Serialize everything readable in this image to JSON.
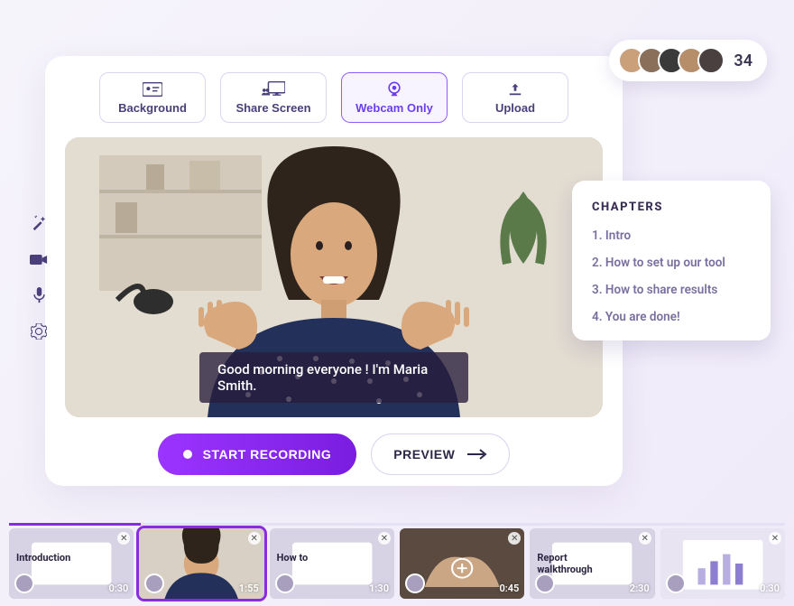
{
  "participants": {
    "count": "34"
  },
  "toolbar": {
    "background_label": "Background",
    "share_label": "Share Screen",
    "webcam_label": "Webcam Only",
    "upload_label": "Upload"
  },
  "caption": "Good morning everyone ! I'm Maria Smith.",
  "actions": {
    "record_label": "START RECORDING",
    "preview_label": "PREVIEW"
  },
  "chapters": {
    "heading": "CHAPTERS",
    "items": [
      "1. Intro",
      "2. How to set up our tool",
      "3. How to share results",
      "4. You are done!"
    ]
  },
  "timeline": {
    "clips": [
      {
        "title": "Introduction",
        "duration": "0:30"
      },
      {
        "title": "",
        "duration": "1:55"
      },
      {
        "title": "How to",
        "duration": "1:30"
      },
      {
        "title": "",
        "duration": "0:45"
      },
      {
        "title": "Report\nwalkthrough",
        "duration": "2:30"
      },
      {
        "title": "",
        "duration": "0:30"
      }
    ]
  },
  "colors": {
    "accent": "#8a2be2"
  }
}
